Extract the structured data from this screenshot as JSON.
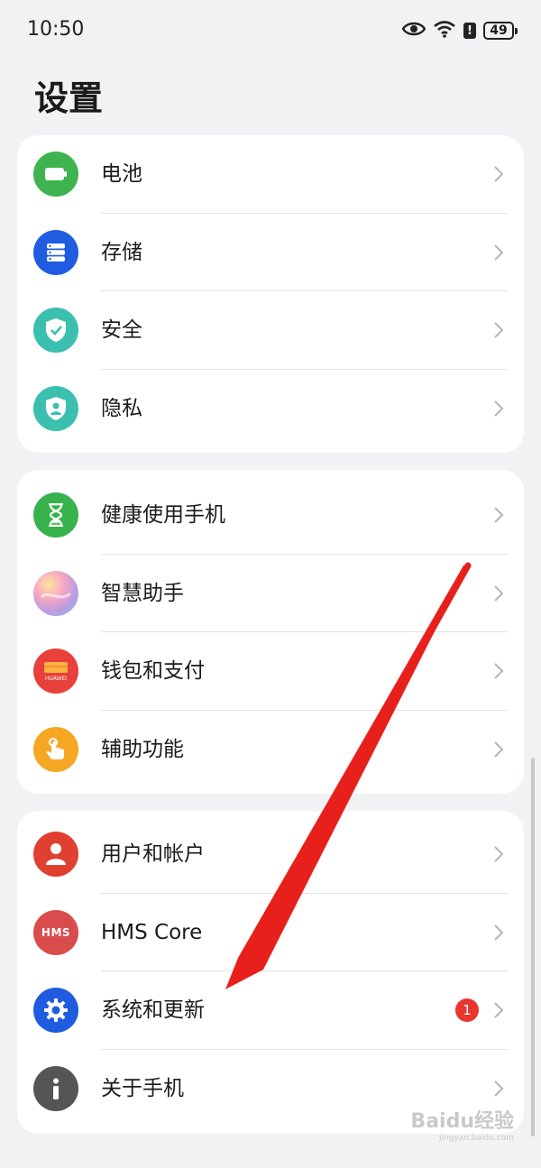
{
  "status_bar": {
    "time": "10:50",
    "battery_level": "49",
    "icons": [
      "eye-icon",
      "wifi-icon",
      "alert-icon",
      "battery-icon"
    ]
  },
  "page": {
    "title": "设置"
  },
  "groups": [
    {
      "items": [
        {
          "label": "电池",
          "icon": "battery-icon",
          "color": "#3fb34f"
        },
        {
          "label": "存储",
          "icon": "storage-icon",
          "color": "#1f5ce0"
        },
        {
          "label": "安全",
          "icon": "security-shield-icon",
          "color": "#3bbfae"
        },
        {
          "label": "隐私",
          "icon": "privacy-shield-icon",
          "color": "#3bbfae"
        }
      ]
    },
    {
      "items": [
        {
          "label": "健康使用手机",
          "icon": "hourglass-icon",
          "color": "#37b24d"
        },
        {
          "label": "智慧助手",
          "icon": "smart-assistant-icon",
          "color": "#b99ce0"
        },
        {
          "label": "钱包和支付",
          "icon": "wallet-icon",
          "color": "#e8403a",
          "icon_text": "HUAWEI"
        },
        {
          "label": "辅助功能",
          "icon": "accessibility-hand-icon",
          "color": "#f5a623"
        }
      ]
    },
    {
      "items": [
        {
          "label": "用户和帐户",
          "icon": "user-icon",
          "color": "#e0402f"
        },
        {
          "label": "HMS Core",
          "icon": "hms-icon",
          "color": "#d84c4c",
          "icon_text": "HMS"
        },
        {
          "label": "系统和更新",
          "icon": "gear-icon",
          "color": "#1f5ce0",
          "badge": "1"
        },
        {
          "label": "关于手机",
          "icon": "info-icon",
          "color": "#555555"
        }
      ]
    }
  ],
  "watermark": {
    "text": "Baidu经验",
    "sub": "jingyan.baidu.com"
  }
}
